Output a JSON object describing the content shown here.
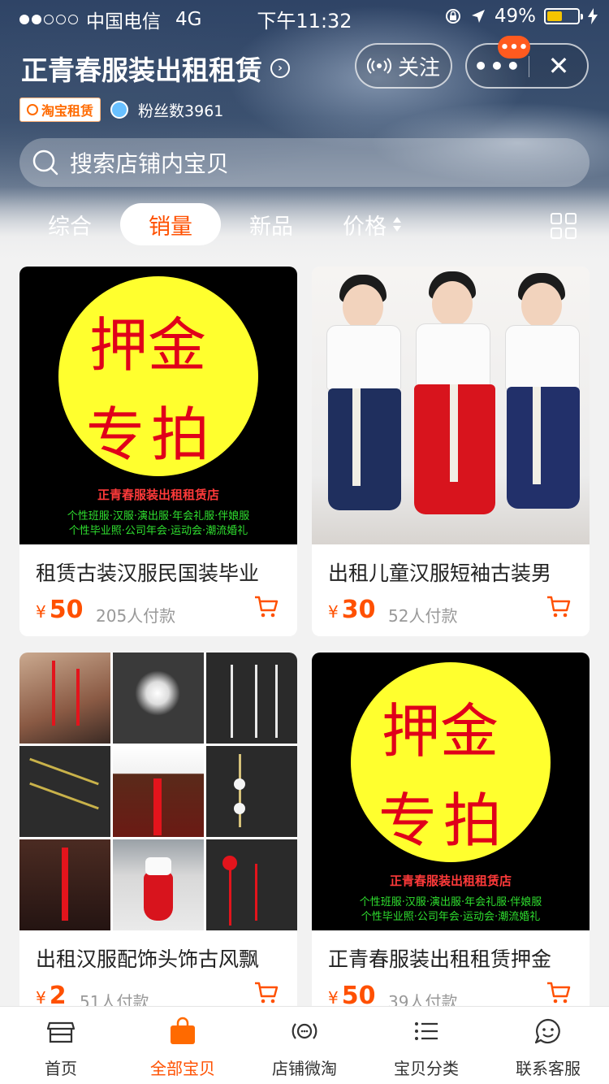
{
  "status_bar": {
    "carrier": "中国电信",
    "network": "4G",
    "time": "下午11:32",
    "battery": "49%",
    "battery_level": 0.49
  },
  "shop": {
    "name": "正青春服装出租租赁",
    "badge": "淘宝租赁",
    "fans": "粉丝数3961",
    "follow_label": "关注",
    "notify_badge": "•••"
  },
  "search": {
    "placeholder": "搜索店铺内宝贝"
  },
  "sort_tabs": [
    {
      "label": "综合"
    },
    {
      "label": "销量"
    },
    {
      "label": "新品"
    },
    {
      "label": "价格"
    }
  ],
  "active_sort": "销量",
  "products": [
    {
      "title": "租赁古装汉服民国装毕业",
      "currency": "¥",
      "price": "50",
      "sold": "205人付款",
      "image": "deposit",
      "image_text": {
        "line1": "押金",
        "line2": "专拍",
        "shop_line": "正青春服装出租租赁店",
        "tags1": "个性班服·汉服·演出服·年会礼服·伴娘服",
        "tags2": "个性毕业照·公司年会·运动会·潮流婚礼"
      }
    },
    {
      "title": "出租儿童汉服短袖古装男",
      "currency": "¥",
      "price": "30",
      "sold": "52人付款",
      "image": "kids-hanfu"
    },
    {
      "title": "出租汉服配饰头饰古风飘",
      "currency": "¥",
      "price": "2",
      "sold": "51人付款",
      "image": "hair-accessories"
    },
    {
      "title": "正青春服装出租租赁押金",
      "currency": "¥",
      "price": "50",
      "sold": "39人付款",
      "image": "deposit",
      "image_text": {
        "line1": "押金",
        "line2": "专拍",
        "shop_line": "正青春服装出租租赁店",
        "tags1": "个性班服·汉服·演出服·年会礼服·伴娘服",
        "tags2": "个性毕业照·公司年会·运动会·潮流婚礼"
      }
    }
  ],
  "tab_bar": [
    {
      "label": "首页",
      "icon": "store-icon"
    },
    {
      "label": "全部宝贝",
      "icon": "shopping-bag-icon"
    },
    {
      "label": "店铺微淘",
      "icon": "broadcast-icon"
    },
    {
      "label": "宝贝分类",
      "icon": "list-icon"
    },
    {
      "label": "联系客服",
      "icon": "chat-face-icon"
    }
  ],
  "colors": {
    "accent": "#ff5000",
    "deposit_yellow": "#ffff2e",
    "deposit_red": "#e0001a"
  }
}
